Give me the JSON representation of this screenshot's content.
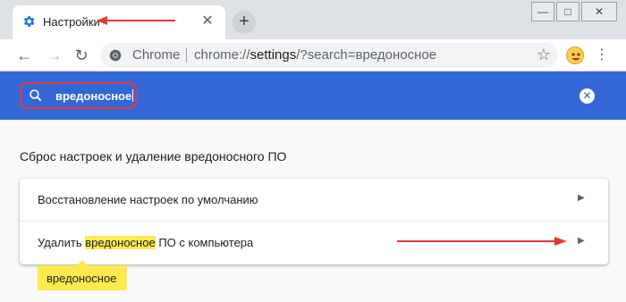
{
  "tab": {
    "title": "Настройки",
    "close_glyph": "✕",
    "icon": "gear-icon"
  },
  "newtab": {
    "glyph": "+"
  },
  "window": {
    "minimize": "—",
    "maximize": "□",
    "close": "✕"
  },
  "toolbar": {
    "back_glyph": "←",
    "forward_glyph": "→",
    "reload_glyph": "↻",
    "site_label": "Chrome",
    "url_prefix": "chrome://",
    "url_bold": "settings",
    "url_rest": "/?search=вредоносное",
    "star_glyph": "☆",
    "menu_glyph": "⋮"
  },
  "search": {
    "query": "вредоносное",
    "clear_glyph": "✕"
  },
  "section": {
    "title": "Сброс настроек и удаление вредоносного ПО"
  },
  "rows": [
    {
      "label": "Восстановление настроек по умолчанию"
    },
    {
      "label_before": "Удалить ",
      "label_highlight": "вредоносное",
      "label_after": " ПО с компьютера"
    }
  ],
  "row_arrow_glyph": "▶",
  "bubble": {
    "text": "вредоносное"
  },
  "colors": {
    "accent": "#3367d6",
    "highlight": "#fee94e",
    "annotation": "#e53935"
  }
}
